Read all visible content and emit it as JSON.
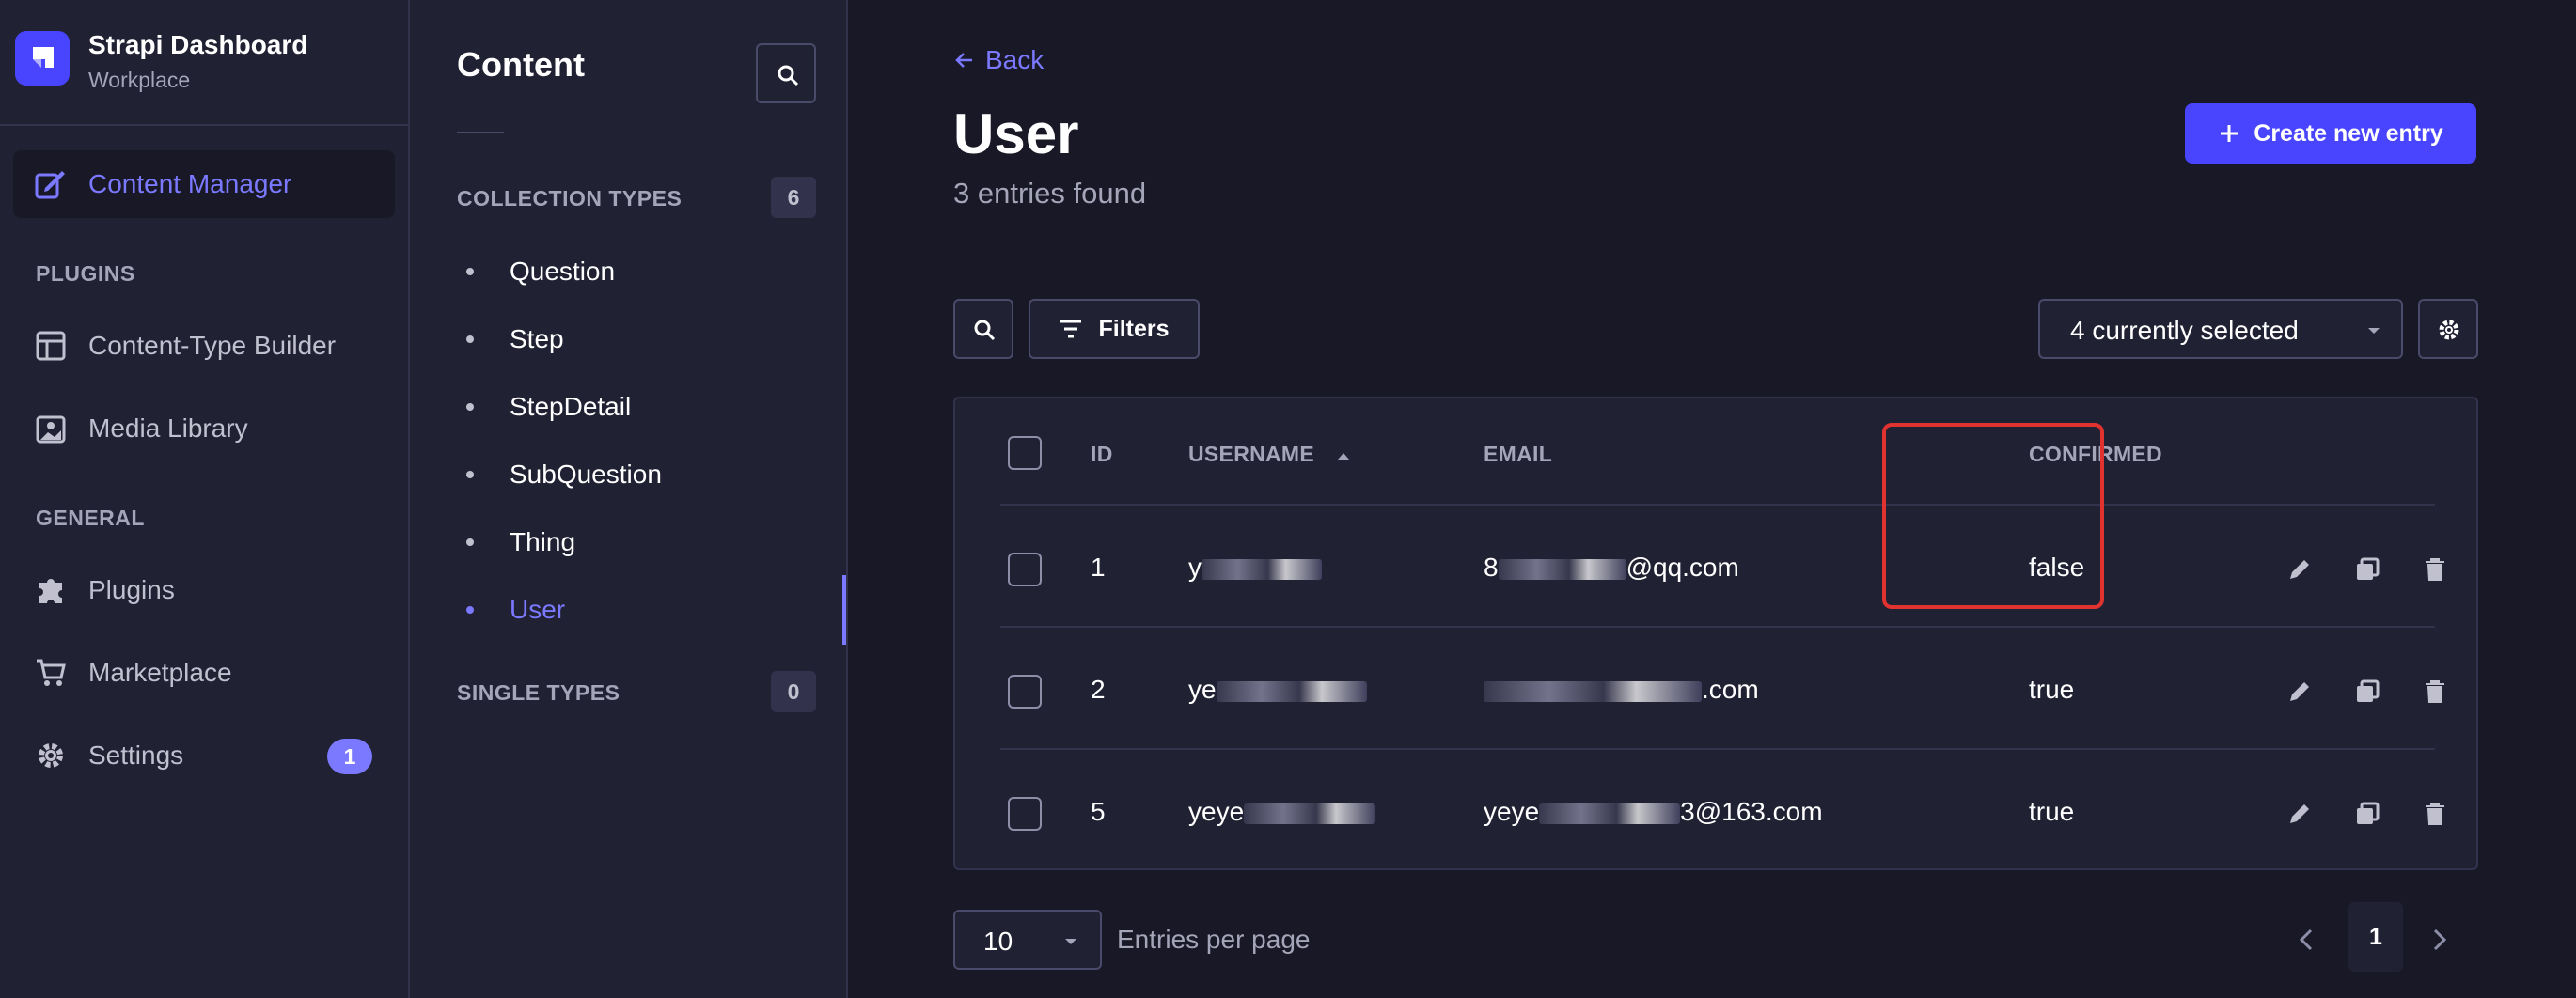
{
  "brand": {
    "title": "Strapi Dashboard",
    "subtitle": "Workplace",
    "accent": "#4945ff"
  },
  "nav": {
    "content_manager": "Content Manager",
    "plugins_section": "PLUGINS",
    "content_type_builder": "Content-Type Builder",
    "media_library": "Media Library",
    "general_section": "GENERAL",
    "plugins": "Plugins",
    "marketplace": "Marketplace",
    "settings": "Settings",
    "settings_badge": "1"
  },
  "subnav": {
    "title": "Content",
    "collection_types_label": "COLLECTION TYPES",
    "collection_types_count": "6",
    "items": [
      "Question",
      "Step",
      "StepDetail",
      "SubQuestion",
      "Thing",
      "User"
    ],
    "active_item": "User",
    "single_types_label": "SINGLE TYPES",
    "single_types_count": "0"
  },
  "main": {
    "back_label": "Back",
    "title": "User",
    "subtitle": "3 entries found",
    "create_button": "Create new entry",
    "filters_label": "Filters",
    "columns_select": "4 currently selected"
  },
  "table": {
    "headers": {
      "id": "ID",
      "username": "USERNAME",
      "email": "EMAIL",
      "confirmed": "CONFIRMED"
    },
    "sort": {
      "column": "username",
      "direction": "ascending"
    },
    "rows": [
      {
        "id": "1",
        "username_visible": "y",
        "email_prefix": "8",
        "email_suffix": "@qq.com",
        "confirmed": "false"
      },
      {
        "id": "2",
        "username_visible": "ye",
        "email_prefix": "",
        "email_suffix": ".com",
        "confirmed": "true"
      },
      {
        "id": "5",
        "username_visible": "yeye",
        "email_prefix": "yeye",
        "email_suffix": "3@163.com",
        "confirmed": "true"
      }
    ]
  },
  "footer": {
    "per_page_value": "10",
    "per_page_label": "Entries per page",
    "current_page": "1"
  },
  "colors": {
    "background": "#181826",
    "panel": "#212134",
    "border": "#32324d",
    "primary": "#4945ff",
    "active_link": "#7b79ff",
    "highlight": "#e0322f"
  }
}
